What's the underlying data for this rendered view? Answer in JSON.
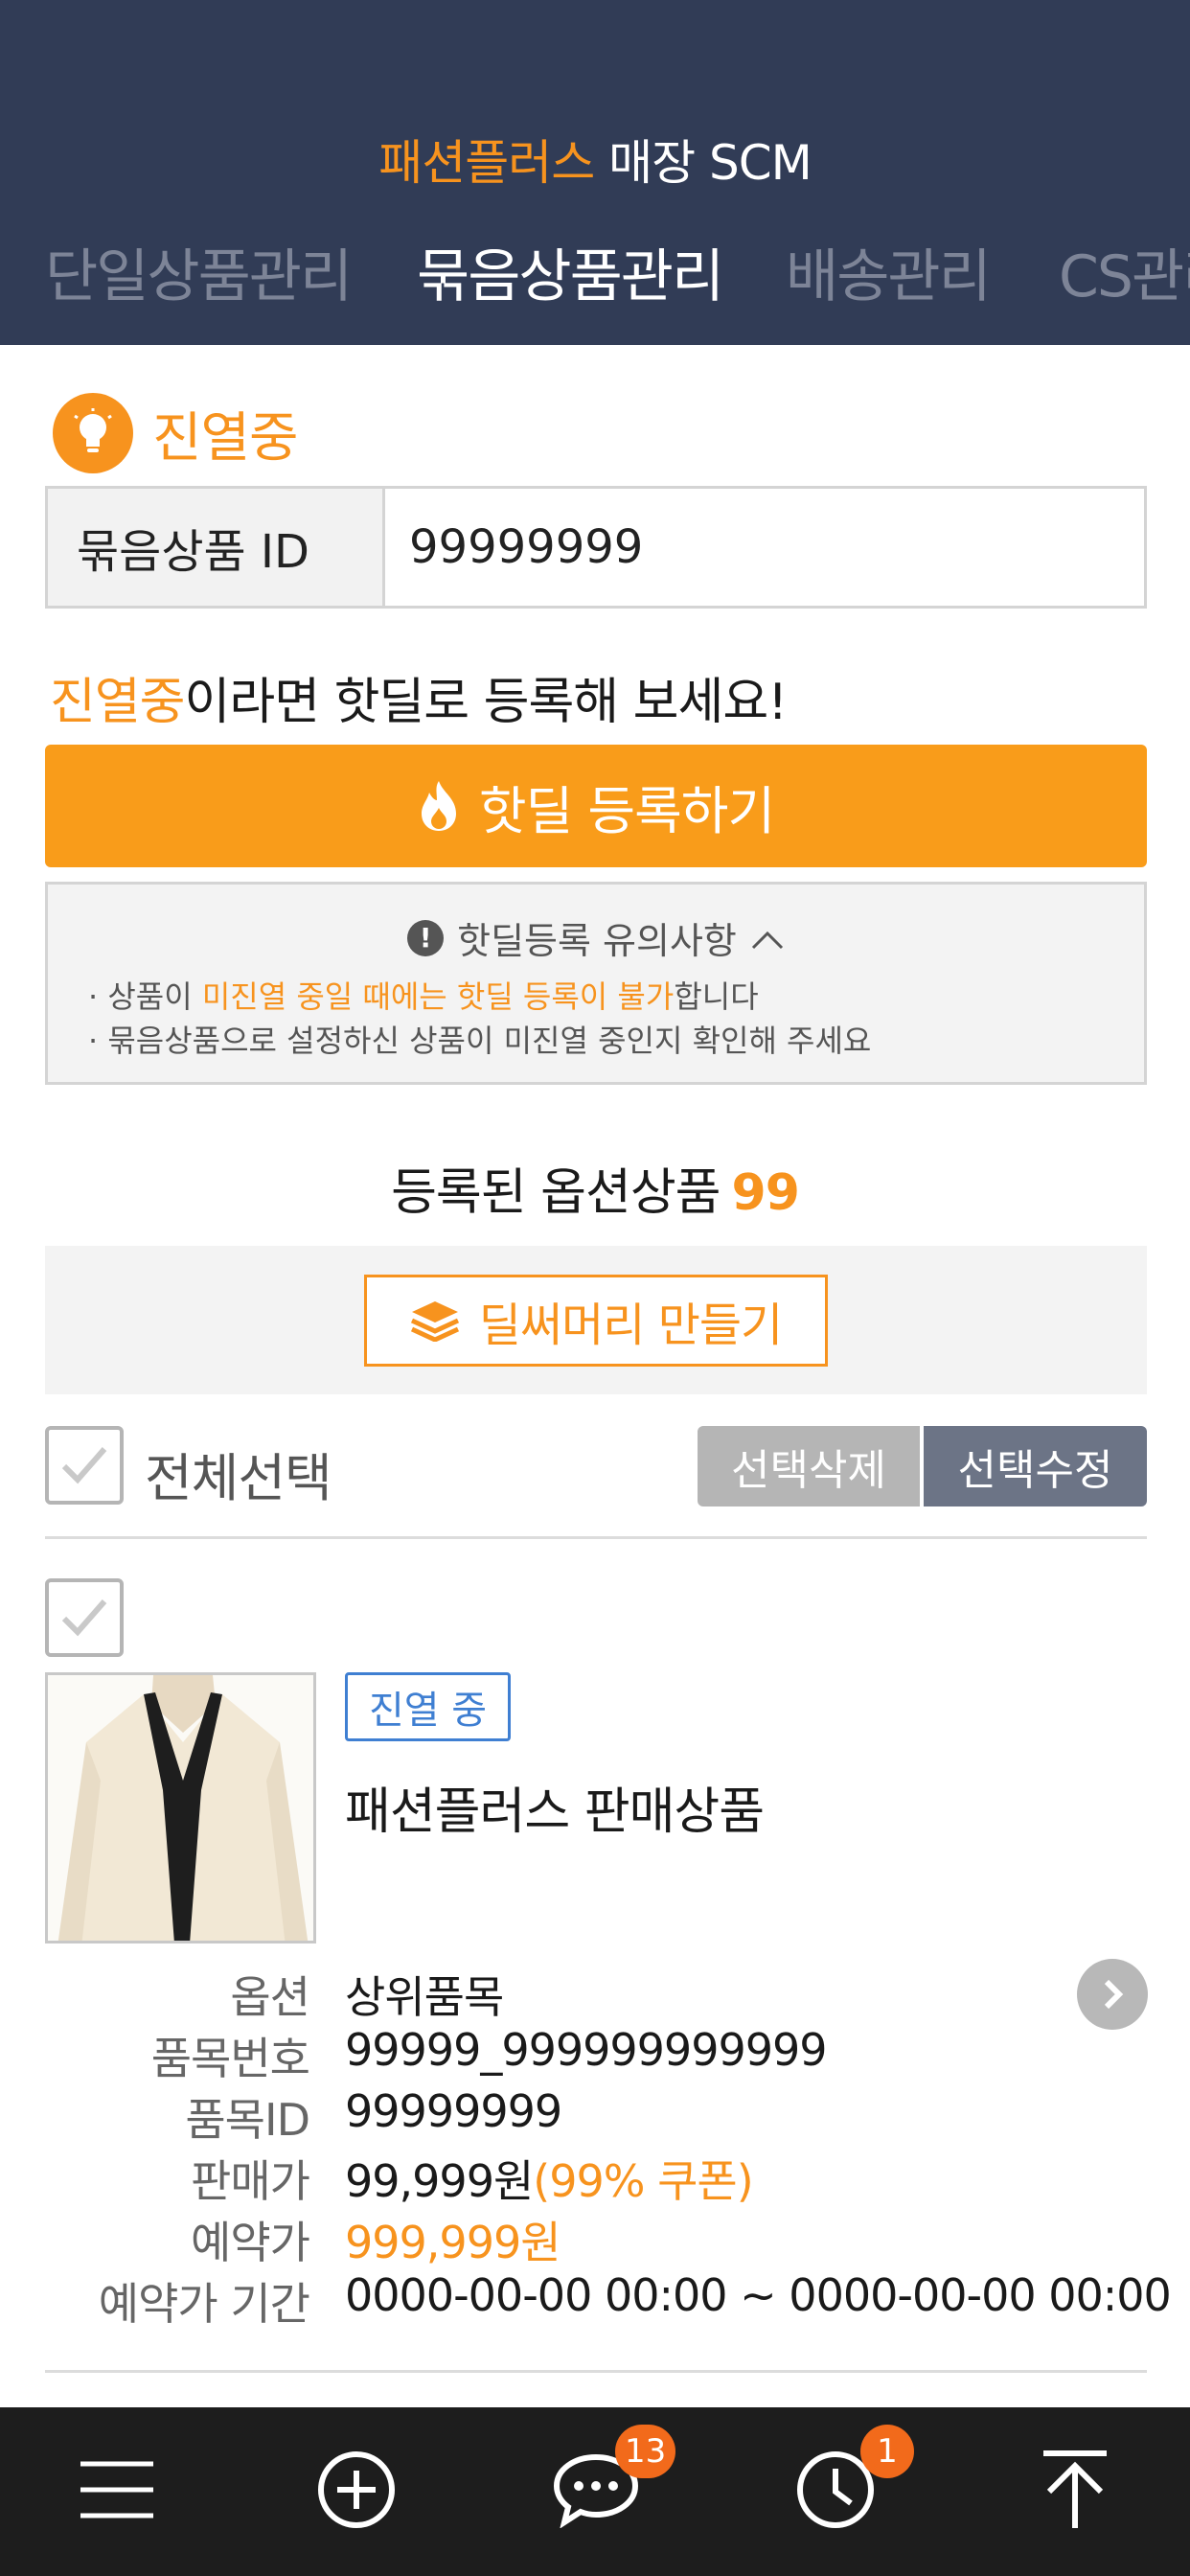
{
  "header": {
    "brand": "패션플러스",
    "title_rest": " 매장 SCM",
    "tabs": [
      {
        "label": "단일상품관리",
        "active": false
      },
      {
        "label": "묶음상품관리",
        "active": true
      },
      {
        "label": "배송관리",
        "active": false
      },
      {
        "label": "CS관리",
        "active": false
      }
    ]
  },
  "status": {
    "label": "진열중",
    "icon": "lightbulb-icon"
  },
  "bundle": {
    "id_label": "묶음상품 ID",
    "id_value": "99999999"
  },
  "hint": {
    "accent": "진열중",
    "rest": "이라면 핫딜로 등록해 보세요!"
  },
  "hotdeal_button": "핫딜 등록하기",
  "notice": {
    "title": "핫딜등록 유의사항",
    "line1_prefix": "· 상품이 ",
    "line1_accent": "미진열 중일 때에는 핫딜 등록이 불가",
    "line1_suffix": "합니다",
    "line2": "· 묶음상품으로 설정하신 상품이 미진열 중인지 확인해 주세요"
  },
  "registered": {
    "label": "등록된 옵션상품",
    "count": "99"
  },
  "headline_button": "딜써머리 만들기",
  "selection": {
    "select_all": "전체선택",
    "delete": "선택삭제",
    "edit": "선택수정"
  },
  "product": {
    "badge": "진열 중",
    "name": "패션플러스 판매상품",
    "rows": [
      {
        "key": "옵션",
        "value": "상위품목"
      },
      {
        "key": "품목번호",
        "value": "99999_999999999999"
      },
      {
        "key": "품목ID",
        "value": "99999999"
      },
      {
        "key": "판매가",
        "value": "99,999원",
        "extra": "(99% 쿠폰)"
      },
      {
        "key": "예약가",
        "value": "999,999원"
      },
      {
        "key": "예약가 기간",
        "value": "0000-00-00 00:00 ~ 0000-00-00 00:00"
      }
    ]
  },
  "bottom_bar": {
    "chat_badge": "13",
    "recent_badge": "1"
  },
  "colors": {
    "header_bg": "#313c56",
    "accent": "#f7931e",
    "badge_blue": "#3f7fd2"
  }
}
